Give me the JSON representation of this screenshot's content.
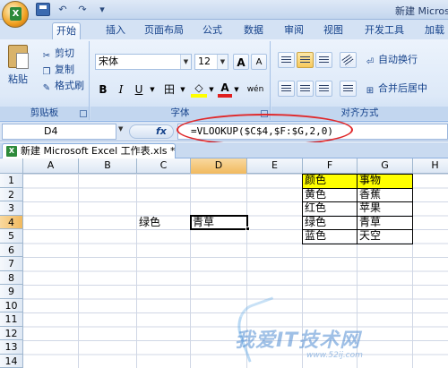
{
  "title_bar": {
    "title": "新建 Micros"
  },
  "office_button": {
    "glyph": "X"
  },
  "qat": {
    "undo": "↶",
    "redo": "↷",
    "dropdown": "▾"
  },
  "tabs": [
    {
      "label": "开始",
      "active": true
    },
    {
      "label": "插入"
    },
    {
      "label": "页面布局"
    },
    {
      "label": "公式"
    },
    {
      "label": "数据"
    },
    {
      "label": "审阅"
    },
    {
      "label": "视图"
    },
    {
      "label": "开发工具"
    },
    {
      "label": "加载"
    }
  ],
  "clipboard": {
    "group_label": "剪贴板",
    "paste": "粘贴",
    "cut": "剪切",
    "copy": "复制",
    "format_painter": "格式刷"
  },
  "font": {
    "group_label": "字体",
    "font_name": "宋体",
    "font_size": "12",
    "grow": "A",
    "shrink": "A",
    "bold": "B",
    "italic": "I",
    "underline": "U",
    "border_icon": "田",
    "fill_icon": "◇",
    "font_color": "A",
    "wen": "wén"
  },
  "alignment": {
    "group_label": "对齐方式",
    "wrap_text": "自动换行",
    "merge_center": "合并后居中"
  },
  "formula_bar": {
    "name_box": "D4",
    "fx": "fx",
    "formula": "=VLOOKUP($C$4,$F:$G,2,0)"
  },
  "workbook_tab": {
    "label": "新建 Microsoft Excel 工作表.xls *"
  },
  "grid": {
    "columns": [
      "A",
      "B",
      "C",
      "D",
      "E",
      "F",
      "G",
      "H"
    ],
    "rows": [
      "1",
      "2",
      "3",
      "4",
      "5",
      "6",
      "7",
      "8",
      "9",
      "10",
      "11",
      "12",
      "13",
      "14"
    ],
    "cells": {
      "F1": "颜色",
      "G1": "事物",
      "F2": "黄色",
      "G2": "香蕉",
      "F3": "红色",
      "G3": "苹果",
      "F4": "绿色",
      "G4": "青草",
      "F5": "蓝色",
      "G5": "天空",
      "C4": "绿色",
      "D4": "青草"
    }
  },
  "watermark": {
    "text": "我爱IT技术网",
    "url": "www.52ij.com"
  }
}
